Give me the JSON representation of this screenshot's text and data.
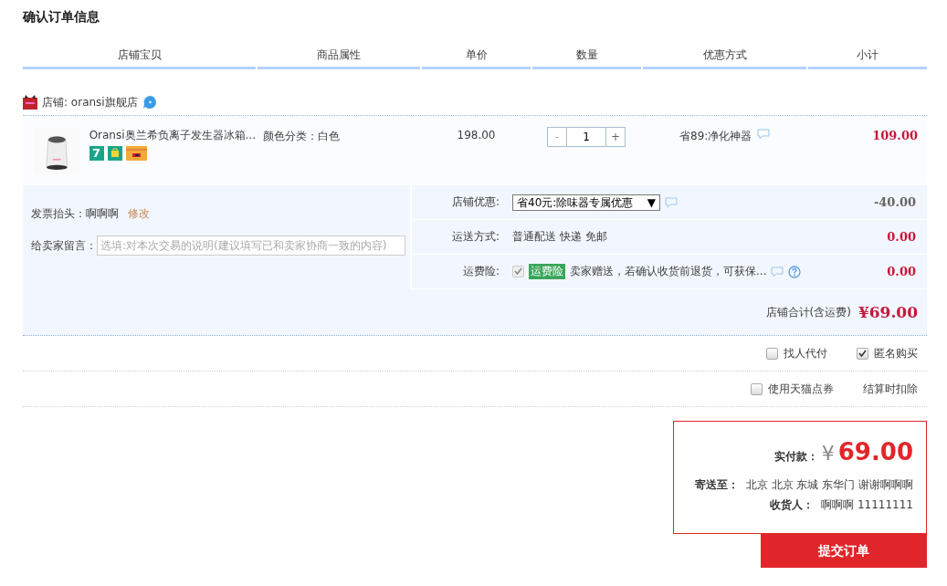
{
  "title": "确认订单信息",
  "columns": [
    "店铺宝贝",
    "商品属性",
    "单价",
    "数量",
    "优惠方式",
    "小计"
  ],
  "shop": {
    "label": "店铺: oransi旗舰店"
  },
  "item": {
    "name": "Oransi奥兰希负离子发生器冰箱...",
    "badge": "7",
    "attribute": "颜色分类：白色",
    "price": "198.00",
    "quantity": "1",
    "minus": "-",
    "plus": "+",
    "promotion": "省89:净化神器",
    "subtotal": "109.00"
  },
  "invoice": {
    "label": "发票抬头：",
    "value": "啊啊啊",
    "link": "修改"
  },
  "message": {
    "label": "给卖家留言：",
    "placeholder": "选填:对本次交易的说明(建议填写已和卖家协商一致的内容)"
  },
  "fees": [
    {
      "kind": "select",
      "label": "店铺优惠:",
      "value": "省40元:除味器专属优惠",
      "arrow": "▼",
      "amount": "-40.00"
    },
    {
      "kind": "text",
      "label": "运送方式:",
      "value": "普通配送 快递 免邮",
      "amount": "0.00"
    },
    {
      "kind": "insurance",
      "label": "运费险:",
      "checked": true,
      "tag": "运费险",
      "value": "卖家赠送，若确认收货前退货，可获保...",
      "amount": "0.00"
    }
  ],
  "shop_total": {
    "label": "店铺合计(含运费)",
    "value": "¥69.00"
  },
  "options": [
    [
      {
        "label": "找人代付",
        "checked": false
      },
      {
        "label": "匿名购买",
        "checked": true
      }
    ],
    [
      {
        "label": "使用天猫点券",
        "checked": false
      },
      {
        "label": "结算时扣除",
        "kind": "note"
      }
    ]
  ],
  "summary": {
    "pay_label": "实付款：",
    "currency": "¥",
    "amount": "69.00",
    "ship_label": "寄送至：",
    "address": "北京 北京 东城 东华门 谢谢啊啊啊",
    "receiver_label": "收货人：",
    "receiver": "啊啊啊 11111111"
  },
  "submit": "提交订单"
}
